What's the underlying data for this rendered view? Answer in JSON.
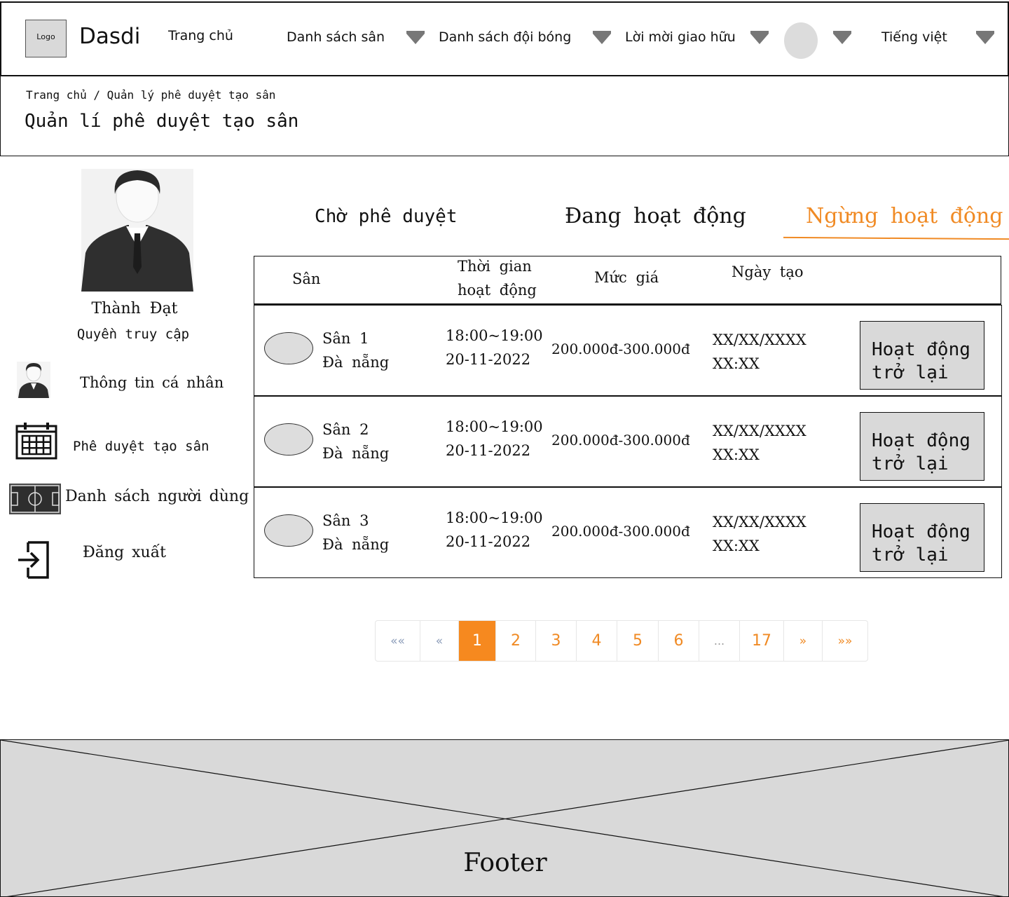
{
  "nav": {
    "logo": "Logo",
    "brand": "Dasdi",
    "home": "Trang chủ",
    "fields": "Danh sách sân",
    "teams": "Danh sách đội bóng",
    "invites": "Lời mời giao hữu",
    "language": "Tiếng việt"
  },
  "header": {
    "breadcrumb": "Trang chủ / Quản lý phê duyệt tạo sân",
    "title": "Quản lí phê duyệt tạo sân"
  },
  "sidebar": {
    "name": "Thành Đạt",
    "role": "Quyền truy cập",
    "items": [
      {
        "label": "Thông tin cá nhân",
        "icon": "person-icon"
      },
      {
        "label": "Phê duyệt tạo sân",
        "icon": "calendar-icon"
      },
      {
        "label": "Danh sách người dùng",
        "icon": "football-field-icon"
      },
      {
        "label": "Đăng xuất",
        "icon": "logout-icon"
      }
    ]
  },
  "tabs": {
    "pending": "Chờ phê duyệt",
    "active": "Đang hoạt động",
    "stopped": "Ngừng hoạt động",
    "selected": "stopped",
    "accent": "#f08a24"
  },
  "table": {
    "headers": {
      "field": "Sân",
      "time_line1": "Thời gian",
      "time_line2": "hoạt động",
      "price": "Mức giá",
      "created": "Ngày tạo"
    },
    "rows": [
      {
        "name": "Sân 1",
        "city": "Đà nẵng",
        "time": "18:00~19:00",
        "date": "20-11-2022",
        "price": "200.000đ-300.000đ",
        "created_date": "XX/XX/XXXX",
        "created_time": "XX:XX",
        "action_line1": "Hoạt động",
        "action_line2": "trở lại"
      },
      {
        "name": "Sân 2",
        "city": "Đà nẵng",
        "time": "18:00~19:00",
        "date": "20-11-2022",
        "price": "200.000đ-300.000đ",
        "created_date": "XX/XX/XXXX",
        "created_time": "XX:XX",
        "action_line1": "Hoạt động",
        "action_line2": "trở lại"
      },
      {
        "name": "Sân 3",
        "city": "Đà nẵng",
        "time": "18:00~19:00",
        "date": "20-11-2022",
        "price": "200.000đ-300.000đ",
        "created_date": "XX/XX/XXXX",
        "created_time": "XX:XX",
        "action_line1": "Hoạt động",
        "action_line2": "trở lại"
      }
    ]
  },
  "pagination": {
    "first": "««",
    "prev": "«",
    "pages": [
      "1",
      "2",
      "3",
      "4",
      "5",
      "6",
      "...",
      "17"
    ],
    "current": "1",
    "next": "»",
    "last": "»»"
  },
  "footer": {
    "label": "Footer"
  }
}
